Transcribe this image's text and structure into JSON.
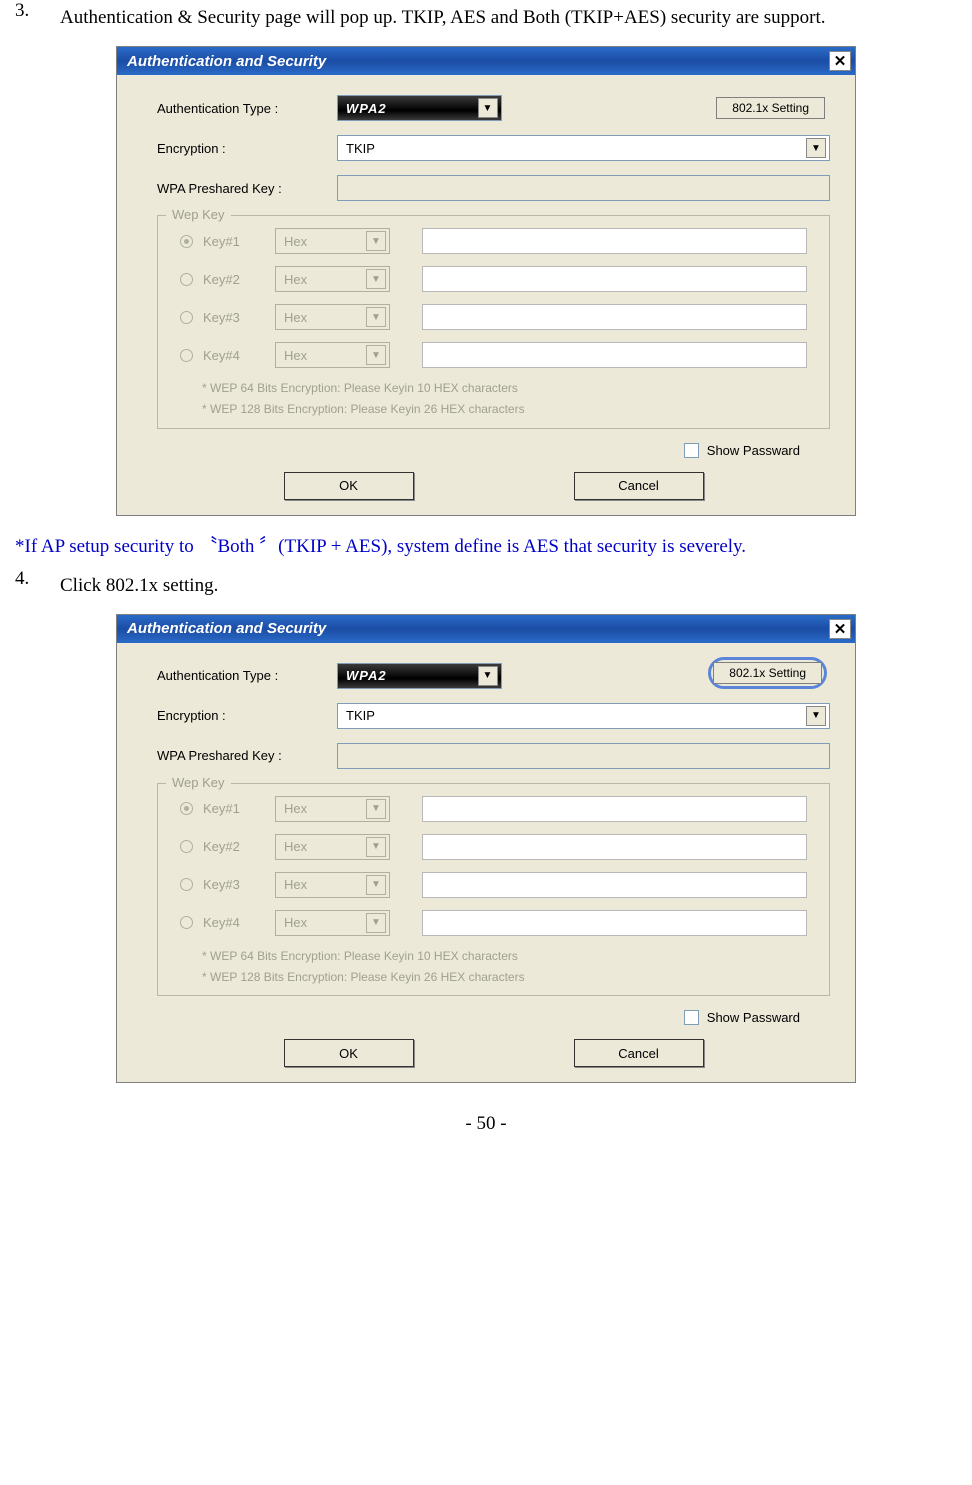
{
  "instructions": {
    "item3_num": "3.",
    "item3_text": "Authentication & Security page will pop up. TKIP, AES and Both (TKIP+AES) security are support.",
    "note": "*If AP setup security to 〝Both 〞(TKIP + AES), system define is AES that security is severely.",
    "item4_num": "4.",
    "item4_text": "Click 802.1x setting."
  },
  "dialog": {
    "title": "Authentication and Security",
    "labels": {
      "auth_type": "Authentication Type :",
      "encryption": "Encryption :",
      "psk": "WPA Preshared Key :"
    },
    "auth_value": "WPA2",
    "encryption_value": "TKIP",
    "btn_8021x": "802.1x Setting",
    "wep": {
      "legend": "Wep Key",
      "key1": "Key#1",
      "key2": "Key#2",
      "key3": "Key#3",
      "key4": "Key#4",
      "hex": "Hex",
      "note1": "* WEP 64 Bits Encryption:    Please Keyin 10 HEX characters",
      "note2": "* WEP 128 Bits Encryption:  Please Keyin 26 HEX characters"
    },
    "show_password": "Show Passward",
    "ok": "OK",
    "cancel": "Cancel"
  },
  "footer": "- 50 -"
}
